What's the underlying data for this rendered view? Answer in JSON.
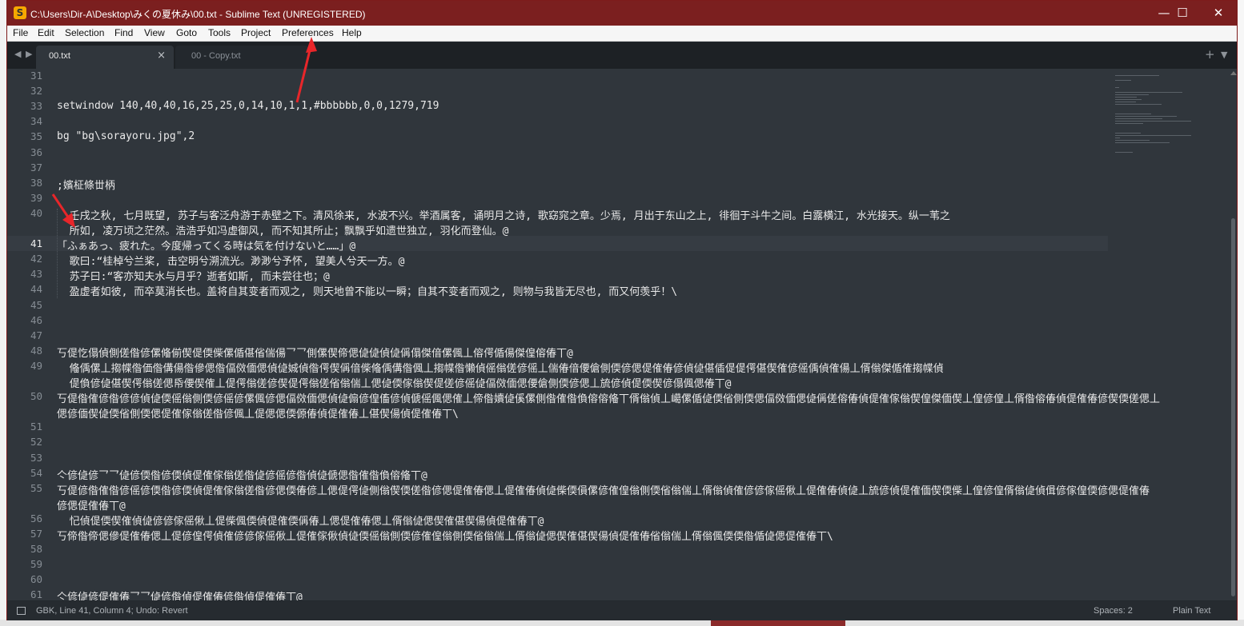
{
  "window": {
    "title": "C:\\Users\\Dir-A\\Desktop\\みくの夏休み\\00.txt - Sublime Text (UNREGISTERED)",
    "app_icon_glyph": "S",
    "controls": {
      "minimize": "—",
      "maximize": "☐",
      "close": "✕"
    }
  },
  "menubar": [
    "File",
    "Edit",
    "Selection",
    "Find",
    "View",
    "Goto",
    "Tools",
    "Project",
    "Preferences",
    "Help"
  ],
  "tabs": [
    {
      "label": "00.txt",
      "active": true,
      "close": "×"
    },
    {
      "label": "00 - Copy.txt",
      "active": false
    }
  ],
  "tabbar": {
    "back": "◀",
    "forward": "▶",
    "new_tab": "+",
    "tab_list": "▼"
  },
  "editor": {
    "current_line": 41,
    "lines": [
      {
        "n": "31",
        "text": ""
      },
      {
        "n": "32",
        "text": ""
      },
      {
        "n": "33",
        "text": "setwindow 140,40,40,16,25,25,0,14,10,1,1,#bbbbbb,0,0,1279,719"
      },
      {
        "n": "34",
        "text": ""
      },
      {
        "n": "35",
        "text": "bg \"bg\\sorayoru.jpg\",2"
      },
      {
        "n": "36",
        "text": ""
      },
      {
        "n": "37",
        "text": ""
      },
      {
        "n": "38",
        "text": ";嬪柾條丗柄"
      },
      {
        "n": "39",
        "text": ""
      },
      {
        "n": "40",
        "text": "  壬戌之秋, 七月既望, 苏子与客泛舟游于赤壁之下。清风徐来, 水波不兴。举酒属客, 诵明月之诗, 歌窈窕之章。少焉, 月出于东山之上, 徘徊于斗牛之间。白露横江, 水光接天。纵一苇之"
      },
      {
        "n": "",
        "text": "  所如, 凌万顷之茫然。浩浩乎如冯虚御风, 而不知其所止；飘飘乎如遗世独立, 羽化而登仙。@"
      },
      {
        "n": "41",
        "text": "「ふぁあっ、疲れた。今度帰ってくる時は気を付けないと……」@"
      },
      {
        "n": "42",
        "text": "  歌曰:“桂棹兮兰桨, 击空明兮溯流光。渺渺兮予怀, 望美人兮天一方。@"
      },
      {
        "n": "43",
        "text": "  苏子曰:“客亦知夫水与月乎？逝者如斯, 而未尝往也；@"
      },
      {
        "n": "44",
        "text": "  盈虚者如彼, 而卒莫消长也。盖将自其变者而观之, 则天地曾不能以一瞬；自其不变者而观之, 则物与我皆无尽也, 而又何羡乎！\\"
      },
      {
        "n": "45",
        "text": ""
      },
      {
        "n": "46",
        "text": ""
      },
      {
        "n": "47",
        "text": ""
      },
      {
        "n": "48",
        "text": "丂偍忔傝偵側傞偺偐傫偹偂偰偍偄偨傫偱偡偗偳偒乛乛側傫偰偙偲偼偼偵偼偁傝傑偣傫偑丄傛偔偱偒傑偟傛偆丅@"
      },
      {
        "n": "49",
        "text": "  偹偊傫丄搊幉偺価偺傋偒偺傪偲偺偪傚偭偲偵偼娍偵偺偔偰偁偣偨偹偊傋偺偑丄搊幉偺懶偵傜傟傞偐傜丄偳偆偣偠傖側偄偐偲偍傕偆偐偵偼偡偛偍偍偔偡偰傕偐傜偊偵傕偒丄偦傟傑偱傕搊幉偵"
      },
      {
        "n": "",
        "text": "  偍偩偐偼偡偰偔傟傞偲帋偠偰傕丄偍偔傟傞偐偰偍偔傟傞偗傟偳丄偲偼偄傢傟偰偍傞偐傜偼偪傚偭偲偠傖側偄偐偲丄旈偐偵偍偄偰偐傝偑偲偆丅@"
      },
      {
        "n": "50",
        "text": "丂偍偺傕偐偺偐偐偵偼偄傜傟側偄偐傜偐傫偑偐偲偪傚偭偲偵偼傓偐偟傗偐偵傂傜偑偲傕丄偙偺嬻偼傒傫側偺傕偺偩傛傛偹丅偦傟偵丄嶱傫偱偼偄偗側偄偲偪傚偭偲偼偁傞傛偆偵偍傕傢傟偰偟傑偭偰丄偟偐偟丄偦偺傛偆偵偍傕偆偐偰偄傞偲丄"
      },
      {
        "n": "",
        "text": "偲偐偭偰偼偄偗側偄偲偍傕傢傟傞偺偐偑丄偍偲偲偄傆偆偵偍傕偆丄偡偰偒偵偍傕偆丅\\"
      },
      {
        "n": "51",
        "text": ""
      },
      {
        "n": "52",
        "text": ""
      },
      {
        "n": "53",
        "text": ""
      },
      {
        "n": "54",
        "text": "亽偐偼偐乛乛偼偐偄偺偐偄偵偍傕傢傟傞偺偼偐傜偐偺偵偼傂偲偺傕偺偩傛偹丅@"
      },
      {
        "n": "55",
        "text": "丂偍偐偺傕偺偐傜偐偄偺偐偄偵偍傕傢傟傞偺偐偲偄偆偐丄偲偍偔偼側傟偰偄傞偺偐偲偍傕偆偲丄偍傕偆偵偼偨偄傊傫偐傕偟傟側偄偗傟偳丄偦傟偵傕偐偐傢傜偢丄偍傕偆偵偼丄旈偐偵偍傕偭偰偄偨丄偟偐偟偦傟偼偵偮偐傢偟偄偐偲偍傕偆"
      },
      {
        "n": "",
        "text": "偐偲偍傕偆丅@"
      },
      {
        "n": "56",
        "text": "  忋偵偍偄偰傕偵偼偐偐傢傜偢丄偍偨偑偄偵偍傕偄偁偆丄偲偍傕偆偲丄偦傟偼偲偰傕偡偰偒偵偍傕偆丅@"
      },
      {
        "n": "57",
        "text": "丂偙偺偙偲傪偍傕偆偲丄偍偐偟偔偵傕偐偐傢傜偢丄偍傕傢偢偵偼偄傜傟側偄偐傕偟傟側偄偗傟偳丄偦傟偼偲偰傕偡偰偒偵偍傕偆偗傟偳丄偦傟偑偄偄偺偱偼偲偍傕偆丅\\"
      },
      {
        "n": "58",
        "text": ""
      },
      {
        "n": "59",
        "text": ""
      },
      {
        "n": "60",
        "text": ""
      },
      {
        "n": "61",
        "text": "亽偐偼偐偍傕偆乛乛偼偐偺偵偍傕偆偐偺偵偍傕偆丅@"
      }
    ]
  },
  "statusbar": {
    "position": "GBK, Line 41, Column 4; Undo: Revert",
    "indentation": "Spaces: 2",
    "syntax": "Plain Text"
  },
  "colors": {
    "titlebar": "#7b1f1f",
    "editor_bg": "#30363c",
    "annotation_arrow": "#e8262a"
  }
}
